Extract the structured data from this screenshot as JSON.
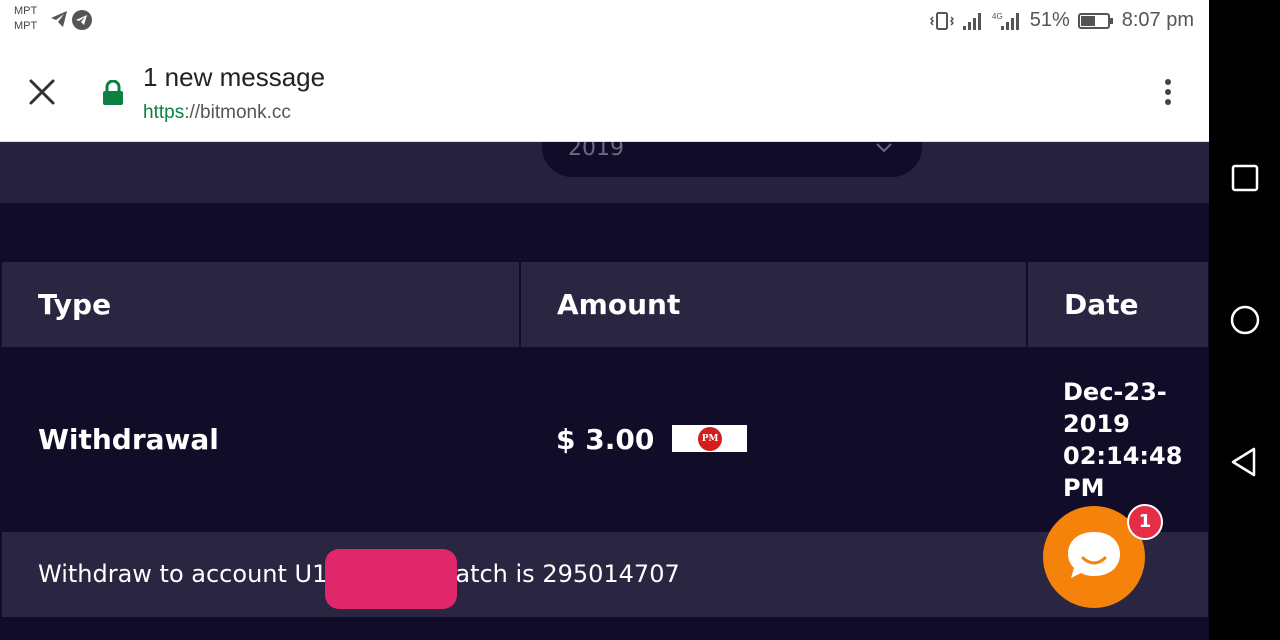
{
  "status_bar": {
    "carrier_1": "MPT",
    "carrier_2": "MPT",
    "battery": "51%",
    "time": "8:07 pm",
    "network_type": "4G",
    "icons": [
      "telegram-icon",
      "telegram-circle-icon",
      "vibrate-icon",
      "signal-icon",
      "signal-4g-icon",
      "battery-icon"
    ]
  },
  "chrome": {
    "title": "1 new message",
    "url_scheme": "https",
    "url_sep": "://",
    "url_host": "bitmonk.cc",
    "lock_color": "#0b8043"
  },
  "filter": {
    "selected_value": "2019"
  },
  "table": {
    "headers": [
      "Type",
      "Amount",
      "Date"
    ],
    "rows": [
      {
        "type": "Withdrawal",
        "amount": "$ 3.00",
        "payment_badge": "PM",
        "date_line1": "Dec-23-",
        "date_line2": "2019",
        "date_line3": "02:14:48",
        "date_line4": "PM",
        "detail_prefix": "Withdraw to account U1",
        "detail_suffix": "atch is 295014707"
      }
    ]
  },
  "chat": {
    "unread_count": "1",
    "button_color": "#f5820a",
    "badge_color": "#e52d47"
  },
  "colors": {
    "page_bg": "#110c28",
    "band_bg": "#26213f",
    "header_bg": "#2a2540",
    "redaction": "#e0276a"
  }
}
